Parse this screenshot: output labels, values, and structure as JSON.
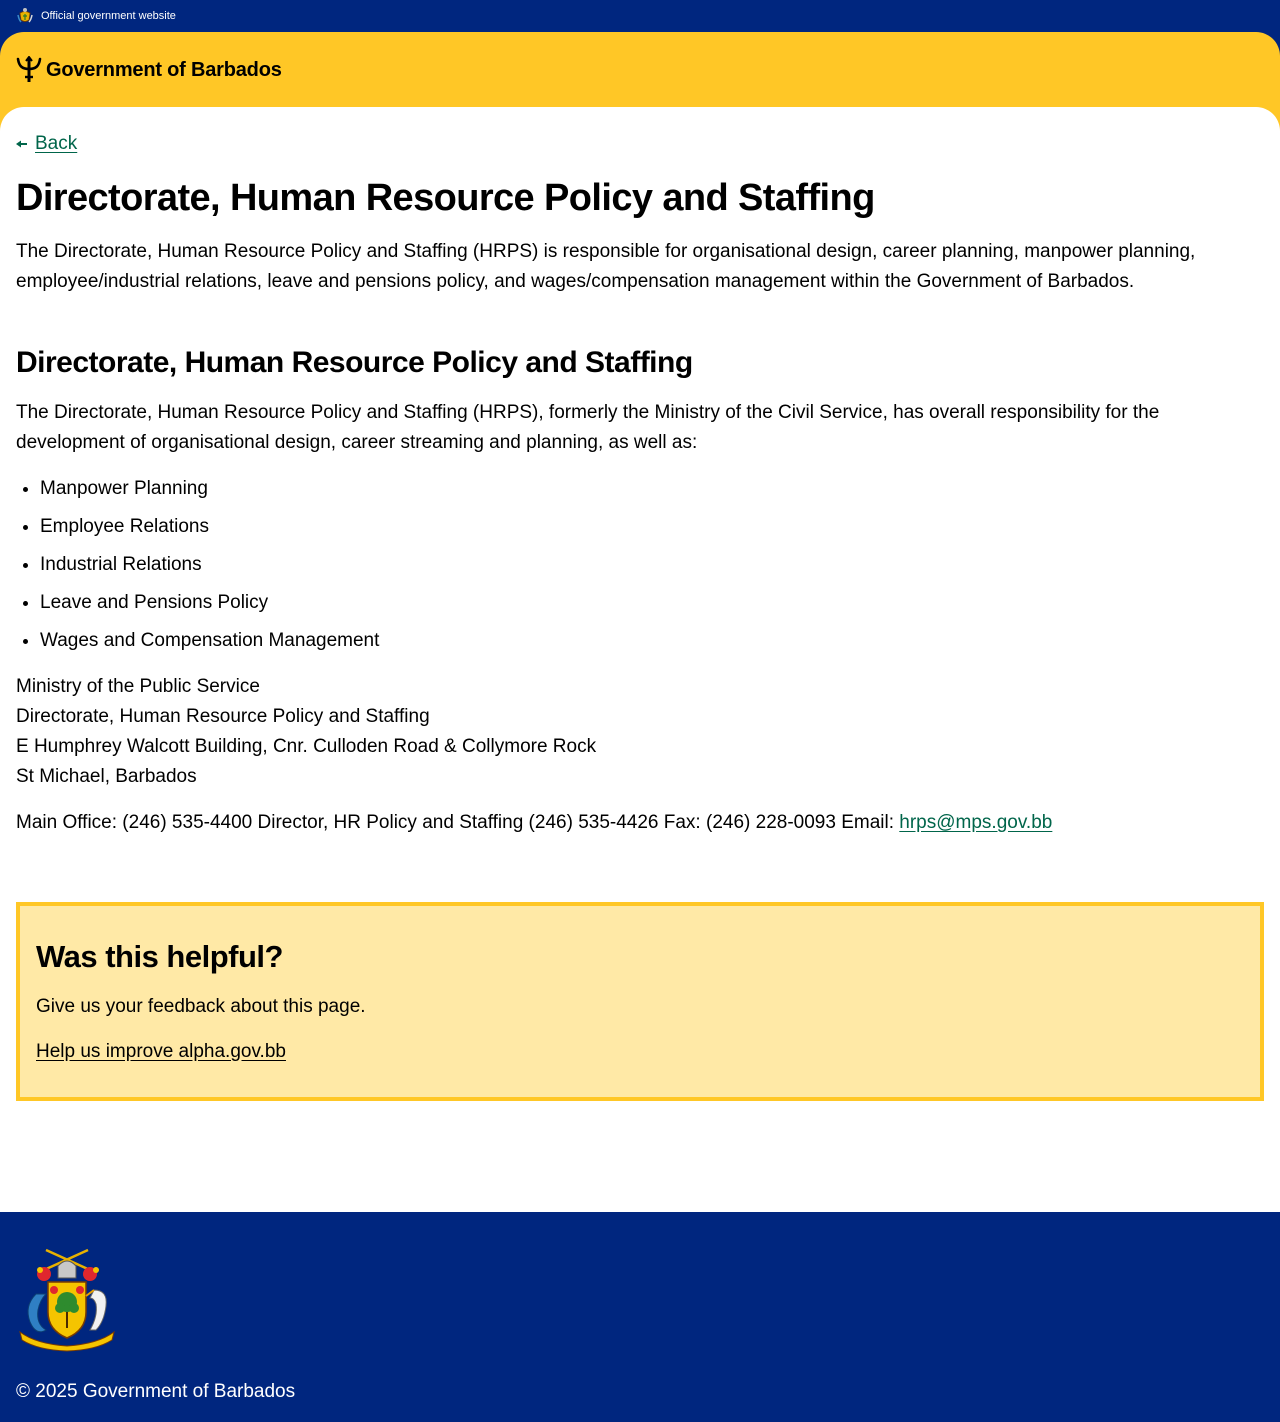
{
  "banner": {
    "text": "Official government website"
  },
  "header": {
    "brand_name": "Government of Barbados"
  },
  "main": {
    "back_label": "Back",
    "title": "Directorate, Human Resource Policy and Staffing",
    "intro": "The Directorate, Human Resource Policy and Staffing (HRPS) is responsible for organisational design, career planning, manpower planning, employee/industrial relations, leave and pensions policy, and wages/compensation management within the Government of Barbados.",
    "section_title": "Directorate, Human Resource Policy and Staffing",
    "section_body": "The Directorate, Human Resource Policy and Staffing (HRPS), formerly the Ministry of the Civil Service, has overall responsibility for the development of organisational design, career streaming and planning, as well as:",
    "responsibilities": [
      "Manpower Planning",
      "Employee Relations",
      "Industrial Relations",
      "Leave and Pensions Policy",
      "Wages and Compensation Management"
    ],
    "address": [
      "Ministry of the Public Service",
      "Directorate, Human Resource Policy and Staffing",
      "E Humphrey Walcott Building, Cnr. Culloden Road & Collymore Rock",
      "St Michael, Barbados"
    ],
    "contacts_text": "Main Office: (246) 535-4400 Director, HR Policy and Staffing (246) 535-4426 Fax: (246) 228-0093 Email: ",
    "email": "hrps@mps.gov.bb"
  },
  "feedback": {
    "title": "Was this helpful?",
    "text": "Give us your feedback about this page.",
    "link": "Help us improve alpha.gov.bb"
  },
  "footer": {
    "copyright": "© 2025 Government of Barbados"
  },
  "colors": {
    "navy": "#00267f",
    "gold": "#ffc726",
    "feedback_bg": "#ffe9a6",
    "link_green": "#00654a"
  },
  "icons": {
    "banner": "coat-of-arms-icon",
    "brand": "trident-icon",
    "back": "arrow-left-icon",
    "footer": "coat-of-arms-icon"
  }
}
